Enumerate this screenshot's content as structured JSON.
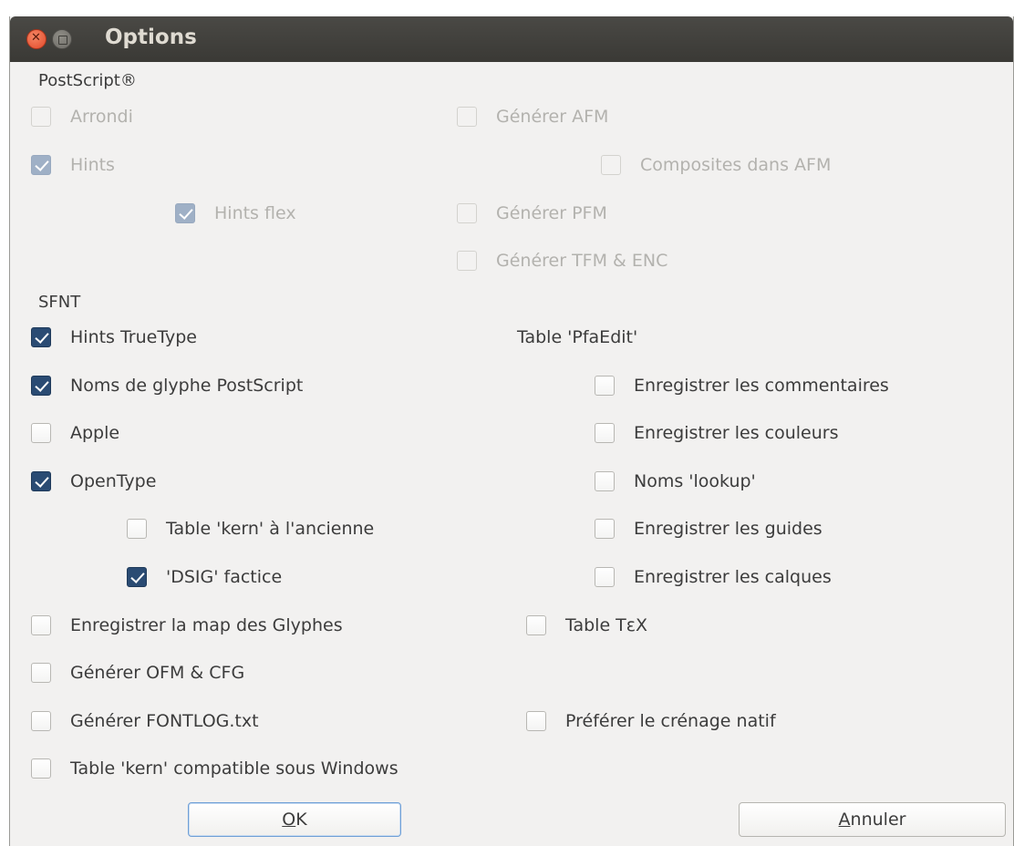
{
  "window": {
    "title": "Options"
  },
  "postscript": {
    "heading": "PostScript®",
    "arrondi": {
      "label": "Arrondi",
      "checked": false,
      "enabled": false
    },
    "hints": {
      "label": "Hints",
      "checked": true,
      "enabled": false
    },
    "hints_flex": {
      "label": "Hints flex",
      "checked": true,
      "enabled": false
    },
    "generer_afm": {
      "label": "Générer AFM",
      "checked": false,
      "enabled": false
    },
    "composites_afm": {
      "label": "Composites dans AFM",
      "checked": false,
      "enabled": false
    },
    "generer_pfm": {
      "label": "Générer PFM",
      "checked": false,
      "enabled": false
    },
    "generer_tfm": {
      "label": "Générer TFM & ENC",
      "checked": false,
      "enabled": false
    }
  },
  "sfnt": {
    "heading": "SFNT",
    "hints_truetype": {
      "label": "Hints TrueType",
      "checked": true
    },
    "noms_glyphe": {
      "label": "Noms de glyphe PostScript",
      "checked": true
    },
    "apple": {
      "label": "Apple",
      "checked": false
    },
    "opentype": {
      "label": "OpenType",
      "checked": true
    },
    "kern_ancienne": {
      "label": "Table 'kern' à l'ancienne",
      "checked": false
    },
    "dsig_factice": {
      "label": "'DSIG' factice",
      "checked": true
    },
    "map_glyphes": {
      "label": "Enregistrer la map des Glyphes",
      "checked": false
    },
    "generer_ofm": {
      "label": "Générer OFM & CFG",
      "checked": false
    },
    "generer_fontlog": {
      "label": "Générer FONTLOG.txt",
      "checked": false
    },
    "kern_windows": {
      "label": "Table 'kern' compatible sous Windows",
      "checked": false
    }
  },
  "pfaedit": {
    "heading": "Table 'PfaEdit'",
    "commentaires": {
      "label": "Enregistrer les commentaires",
      "checked": false
    },
    "couleurs": {
      "label": "Enregistrer les couleurs",
      "checked": false
    },
    "lookup": {
      "label": "Noms 'lookup'",
      "checked": false
    },
    "guides": {
      "label": "Enregistrer les guides",
      "checked": false
    },
    "calques": {
      "label": "Enregistrer les calques",
      "checked": false
    }
  },
  "table_tex": {
    "label": "Table TεX",
    "checked": false
  },
  "crenage_natif": {
    "label": "Préférer le crénage natif",
    "checked": false
  },
  "buttons": {
    "ok": {
      "mnemonic": "O",
      "rest": "K"
    },
    "annuler": {
      "mnemonic": "A",
      "rest": "nnuler"
    }
  }
}
